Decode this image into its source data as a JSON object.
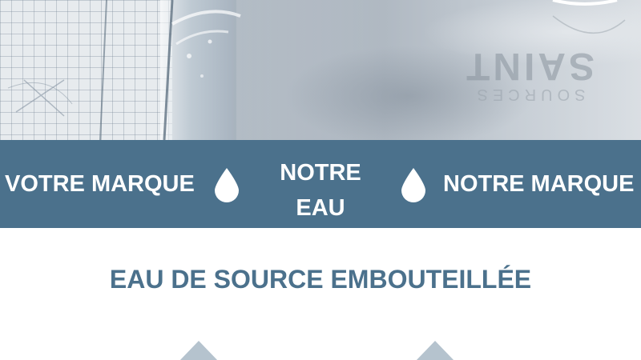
{
  "hero": {
    "brand_name": "SAINT",
    "brand_subtitle": "SOURCES"
  },
  "band": {
    "background_color": "#4b718c",
    "items": [
      {
        "label": "VOTRE MARQUE"
      },
      {
        "label_line1": "NOTRE",
        "label_line2": "EAU"
      },
      {
        "label": "NOTRE MARQUE"
      }
    ],
    "separator_icon": "water-drop-icon"
  },
  "section": {
    "title": "EAU DE SOURCE EMBOUTEILLÉE",
    "title_color": "#4b718c"
  },
  "decorations": {
    "peak_icon": "triangle-peak-icon",
    "peak_color": "#b5c3ce"
  }
}
